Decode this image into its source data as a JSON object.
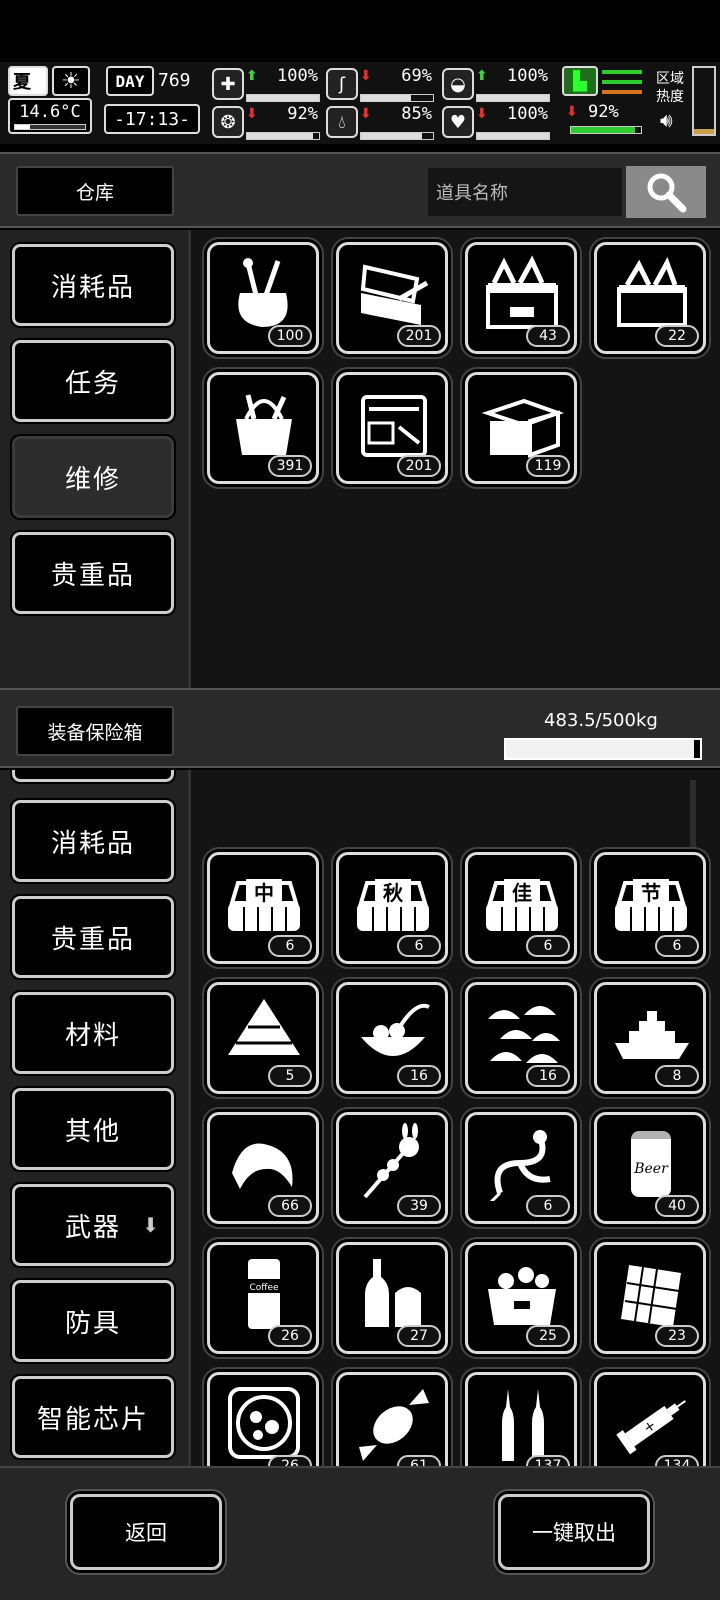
{
  "status_bar": {
    "season": "夏",
    "temperature": "14.6°C",
    "day_label": "DAY",
    "day": "769",
    "time": "-17:13-",
    "region_label": "区域热度",
    "stats": [
      {
        "name": "health",
        "icon": "medkit-icon",
        "trend": "up",
        "value": "100%",
        "level": 1.0
      },
      {
        "name": "hunger",
        "icon": "stomach-icon",
        "trend": "down",
        "value": "69%",
        "level": 0.69
      },
      {
        "name": "immunity",
        "icon": "pill-icon",
        "trend": "up",
        "value": "100%",
        "level": 1.0
      },
      {
        "name": "mental",
        "icon": "brain-icon",
        "trend": "down",
        "value": "92%",
        "level": 0.92
      },
      {
        "name": "thirst",
        "icon": "water-drop-icon",
        "trend": "down",
        "value": "85%",
        "level": 0.85
      },
      {
        "name": "mood",
        "icon": "heart-icon",
        "trend": "down",
        "value": "100%",
        "level": 1.0
      },
      {
        "name": "stamina",
        "icon": "boot-icon",
        "trend": "down",
        "value": "92%",
        "level": 0.92
      }
    ]
  },
  "warehouse": {
    "title": "仓库",
    "search_placeholder": "道具名称",
    "tabs": [
      "消耗品",
      "任务",
      "维修",
      "贵重品"
    ],
    "active_tab": "维修",
    "items": [
      {
        "icon": "tool-bag-icon",
        "count": "100"
      },
      {
        "icon": "open-toolbox-icon",
        "count": "201"
      },
      {
        "icon": "large-toolbox-icon",
        "count": "43"
      },
      {
        "icon": "toolbox-icon",
        "count": "22"
      },
      {
        "icon": "tool-bucket-icon",
        "count": "391"
      },
      {
        "icon": "tool-case-icon",
        "count": "201"
      },
      {
        "icon": "cantilever-toolbox-icon",
        "count": "119"
      }
    ]
  },
  "safe_box": {
    "title": "装备保险箱",
    "weight": "483.5/500kg",
    "weight_fill": 0.967,
    "tabs": [
      "消耗品",
      "贵重品",
      "材料",
      "其他",
      "武器",
      "防具",
      "智能芯片"
    ],
    "items": [
      {
        "icon": "mooncake-zhong-icon",
        "glyph": "中",
        "count": "6"
      },
      {
        "icon": "mooncake-qiu-icon",
        "glyph": "秋",
        "count": "6"
      },
      {
        "icon": "mooncake-jia-icon",
        "glyph": "佳",
        "count": "6"
      },
      {
        "icon": "mooncake-jie-icon",
        "glyph": "节",
        "count": "6"
      },
      {
        "icon": "zongzi-icon",
        "count": "5"
      },
      {
        "icon": "tangyuan-bowl-icon",
        "count": "16"
      },
      {
        "icon": "dumplings-icon",
        "count": "16"
      },
      {
        "icon": "ship-icon",
        "count": "8"
      },
      {
        "icon": "croissant-icon",
        "count": "66"
      },
      {
        "icon": "rabbit-candy-stick-icon",
        "count": "39"
      },
      {
        "icon": "dragon-sugar-painting-icon",
        "count": "6"
      },
      {
        "icon": "beer-can-icon",
        "count": "40"
      },
      {
        "icon": "coffee-can-icon",
        "count": "26"
      },
      {
        "icon": "bottle-drinks-icon",
        "count": "27"
      },
      {
        "icon": "food-box-icon",
        "count": "25"
      },
      {
        "icon": "chocolate-bar-icon",
        "count": "23"
      },
      {
        "icon": "hotpot-icon",
        "count": "26"
      },
      {
        "icon": "candy-icon",
        "count": "61"
      },
      {
        "icon": "ampoule-icon",
        "count": "137"
      },
      {
        "icon": "syringe-icon",
        "count": "134"
      }
    ]
  },
  "footer": {
    "back_label": "返回",
    "take_all_label": "一键取出"
  },
  "colors": {
    "up": "#3fd43f",
    "down": "#e63030",
    "panel": "#2a2a2a",
    "grid_bg": "#141414"
  }
}
